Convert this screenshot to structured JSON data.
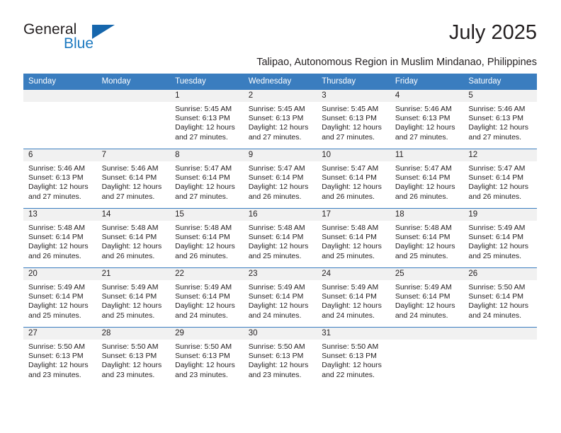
{
  "brand": {
    "name_part1": "General",
    "name_part2": "Blue",
    "triangle_color": "#1666ac",
    "blue_color": "#1c79c0"
  },
  "header": {
    "month_title": "July 2025",
    "subtitle": "Talipao, Autonomous Region in Muslim Mindanao, Philippines"
  },
  "theme": {
    "header_bg": "#3a7dbf",
    "daynum_bg": "#f1f1f1",
    "text": "#231f20"
  },
  "weekdays": [
    "Sunday",
    "Monday",
    "Tuesday",
    "Wednesday",
    "Thursday",
    "Friday",
    "Saturday"
  ],
  "weeks": [
    [
      {
        "day": "",
        "sunrise": "",
        "sunset": "",
        "daylight_line1": "",
        "daylight_line2": ""
      },
      {
        "day": "",
        "sunrise": "",
        "sunset": "",
        "daylight_line1": "",
        "daylight_line2": ""
      },
      {
        "day": "1",
        "sunrise": "Sunrise: 5:45 AM",
        "sunset": "Sunset: 6:13 PM",
        "daylight_line1": "Daylight: 12 hours",
        "daylight_line2": "and 27 minutes."
      },
      {
        "day": "2",
        "sunrise": "Sunrise: 5:45 AM",
        "sunset": "Sunset: 6:13 PM",
        "daylight_line1": "Daylight: 12 hours",
        "daylight_line2": "and 27 minutes."
      },
      {
        "day": "3",
        "sunrise": "Sunrise: 5:45 AM",
        "sunset": "Sunset: 6:13 PM",
        "daylight_line1": "Daylight: 12 hours",
        "daylight_line2": "and 27 minutes."
      },
      {
        "day": "4",
        "sunrise": "Sunrise: 5:46 AM",
        "sunset": "Sunset: 6:13 PM",
        "daylight_line1": "Daylight: 12 hours",
        "daylight_line2": "and 27 minutes."
      },
      {
        "day": "5",
        "sunrise": "Sunrise: 5:46 AM",
        "sunset": "Sunset: 6:13 PM",
        "daylight_line1": "Daylight: 12 hours",
        "daylight_line2": "and 27 minutes."
      }
    ],
    [
      {
        "day": "6",
        "sunrise": "Sunrise: 5:46 AM",
        "sunset": "Sunset: 6:13 PM",
        "daylight_line1": "Daylight: 12 hours",
        "daylight_line2": "and 27 minutes."
      },
      {
        "day": "7",
        "sunrise": "Sunrise: 5:46 AM",
        "sunset": "Sunset: 6:14 PM",
        "daylight_line1": "Daylight: 12 hours",
        "daylight_line2": "and 27 minutes."
      },
      {
        "day": "8",
        "sunrise": "Sunrise: 5:47 AM",
        "sunset": "Sunset: 6:14 PM",
        "daylight_line1": "Daylight: 12 hours",
        "daylight_line2": "and 27 minutes."
      },
      {
        "day": "9",
        "sunrise": "Sunrise: 5:47 AM",
        "sunset": "Sunset: 6:14 PM",
        "daylight_line1": "Daylight: 12 hours",
        "daylight_line2": "and 26 minutes."
      },
      {
        "day": "10",
        "sunrise": "Sunrise: 5:47 AM",
        "sunset": "Sunset: 6:14 PM",
        "daylight_line1": "Daylight: 12 hours",
        "daylight_line2": "and 26 minutes."
      },
      {
        "day": "11",
        "sunrise": "Sunrise: 5:47 AM",
        "sunset": "Sunset: 6:14 PM",
        "daylight_line1": "Daylight: 12 hours",
        "daylight_line2": "and 26 minutes."
      },
      {
        "day": "12",
        "sunrise": "Sunrise: 5:47 AM",
        "sunset": "Sunset: 6:14 PM",
        "daylight_line1": "Daylight: 12 hours",
        "daylight_line2": "and 26 minutes."
      }
    ],
    [
      {
        "day": "13",
        "sunrise": "Sunrise: 5:48 AM",
        "sunset": "Sunset: 6:14 PM",
        "daylight_line1": "Daylight: 12 hours",
        "daylight_line2": "and 26 minutes."
      },
      {
        "day": "14",
        "sunrise": "Sunrise: 5:48 AM",
        "sunset": "Sunset: 6:14 PM",
        "daylight_line1": "Daylight: 12 hours",
        "daylight_line2": "and 26 minutes."
      },
      {
        "day": "15",
        "sunrise": "Sunrise: 5:48 AM",
        "sunset": "Sunset: 6:14 PM",
        "daylight_line1": "Daylight: 12 hours",
        "daylight_line2": "and 26 minutes."
      },
      {
        "day": "16",
        "sunrise": "Sunrise: 5:48 AM",
        "sunset": "Sunset: 6:14 PM",
        "daylight_line1": "Daylight: 12 hours",
        "daylight_line2": "and 25 minutes."
      },
      {
        "day": "17",
        "sunrise": "Sunrise: 5:48 AM",
        "sunset": "Sunset: 6:14 PM",
        "daylight_line1": "Daylight: 12 hours",
        "daylight_line2": "and 25 minutes."
      },
      {
        "day": "18",
        "sunrise": "Sunrise: 5:48 AM",
        "sunset": "Sunset: 6:14 PM",
        "daylight_line1": "Daylight: 12 hours",
        "daylight_line2": "and 25 minutes."
      },
      {
        "day": "19",
        "sunrise": "Sunrise: 5:49 AM",
        "sunset": "Sunset: 6:14 PM",
        "daylight_line1": "Daylight: 12 hours",
        "daylight_line2": "and 25 minutes."
      }
    ],
    [
      {
        "day": "20",
        "sunrise": "Sunrise: 5:49 AM",
        "sunset": "Sunset: 6:14 PM",
        "daylight_line1": "Daylight: 12 hours",
        "daylight_line2": "and 25 minutes."
      },
      {
        "day": "21",
        "sunrise": "Sunrise: 5:49 AM",
        "sunset": "Sunset: 6:14 PM",
        "daylight_line1": "Daylight: 12 hours",
        "daylight_line2": "and 25 minutes."
      },
      {
        "day": "22",
        "sunrise": "Sunrise: 5:49 AM",
        "sunset": "Sunset: 6:14 PM",
        "daylight_line1": "Daylight: 12 hours",
        "daylight_line2": "and 24 minutes."
      },
      {
        "day": "23",
        "sunrise": "Sunrise: 5:49 AM",
        "sunset": "Sunset: 6:14 PM",
        "daylight_line1": "Daylight: 12 hours",
        "daylight_line2": "and 24 minutes."
      },
      {
        "day": "24",
        "sunrise": "Sunrise: 5:49 AM",
        "sunset": "Sunset: 6:14 PM",
        "daylight_line1": "Daylight: 12 hours",
        "daylight_line2": "and 24 minutes."
      },
      {
        "day": "25",
        "sunrise": "Sunrise: 5:49 AM",
        "sunset": "Sunset: 6:14 PM",
        "daylight_line1": "Daylight: 12 hours",
        "daylight_line2": "and 24 minutes."
      },
      {
        "day": "26",
        "sunrise": "Sunrise: 5:50 AM",
        "sunset": "Sunset: 6:14 PM",
        "daylight_line1": "Daylight: 12 hours",
        "daylight_line2": "and 24 minutes."
      }
    ],
    [
      {
        "day": "27",
        "sunrise": "Sunrise: 5:50 AM",
        "sunset": "Sunset: 6:13 PM",
        "daylight_line1": "Daylight: 12 hours",
        "daylight_line2": "and 23 minutes."
      },
      {
        "day": "28",
        "sunrise": "Sunrise: 5:50 AM",
        "sunset": "Sunset: 6:13 PM",
        "daylight_line1": "Daylight: 12 hours",
        "daylight_line2": "and 23 minutes."
      },
      {
        "day": "29",
        "sunrise": "Sunrise: 5:50 AM",
        "sunset": "Sunset: 6:13 PM",
        "daylight_line1": "Daylight: 12 hours",
        "daylight_line2": "and 23 minutes."
      },
      {
        "day": "30",
        "sunrise": "Sunrise: 5:50 AM",
        "sunset": "Sunset: 6:13 PM",
        "daylight_line1": "Daylight: 12 hours",
        "daylight_line2": "and 23 minutes."
      },
      {
        "day": "31",
        "sunrise": "Sunrise: 5:50 AM",
        "sunset": "Sunset: 6:13 PM",
        "daylight_line1": "Daylight: 12 hours",
        "daylight_line2": "and 22 minutes."
      },
      {
        "day": "",
        "sunrise": "",
        "sunset": "",
        "daylight_line1": "",
        "daylight_line2": ""
      },
      {
        "day": "",
        "sunrise": "",
        "sunset": "",
        "daylight_line1": "",
        "daylight_line2": ""
      }
    ]
  ]
}
